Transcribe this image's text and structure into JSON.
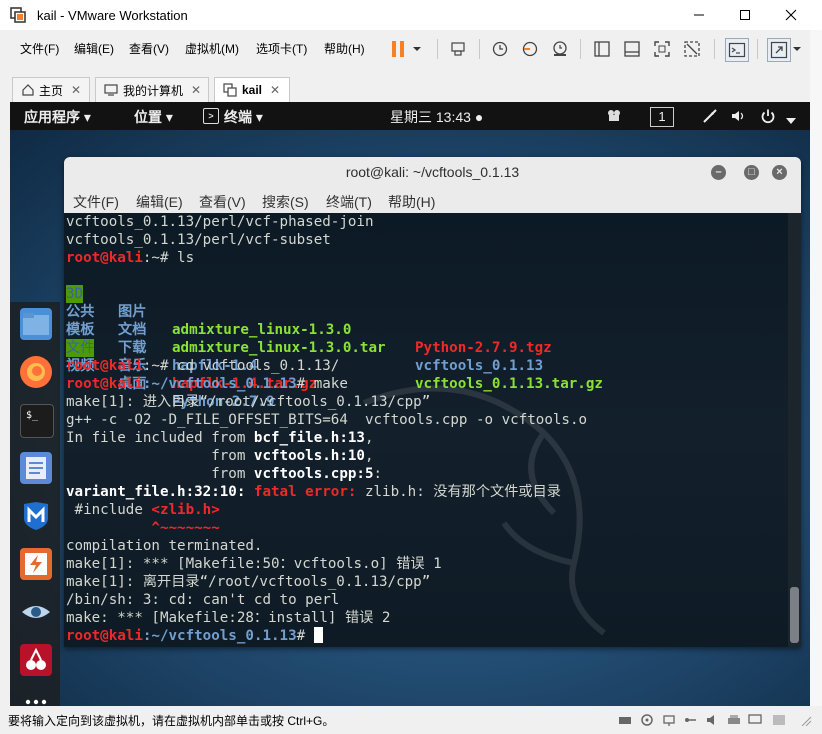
{
  "window": {
    "title": "kail - VMware Workstation"
  },
  "menubar": {
    "file": "文件(F)",
    "edit": "编辑(E)",
    "view": "查看(V)",
    "vm": "虚拟机(M)",
    "tabs": "选项卡(T)",
    "help": "帮助(H)"
  },
  "tabs": [
    {
      "label": "主页"
    },
    {
      "label": "我的计算机"
    },
    {
      "label": "kail"
    }
  ],
  "gnome": {
    "apps": "应用程序 ▾",
    "places": "位置 ▾",
    "terminal": "终端 ▾",
    "clock": "星期三 13:43 ●",
    "workspace": "1"
  },
  "terminal": {
    "title": "root@kali: ~/vcftools_0.1.13",
    "menu": {
      "file": "文件(F)",
      "edit": "编辑(E)",
      "view": "查看(V)",
      "search": "搜索(S)",
      "terminal": "终端(T)",
      "help": "帮助(H)"
    },
    "lines": {
      "l1": "vcftools_0.1.13/perl/vcf-phased-join",
      "l2": "vcftools_0.1.13/perl/vcf-subset",
      "l3_prompt_user": "root@kali",
      "l3_rest": ":~# ls",
      "ls_r1_c1": "3D",
      "ls_r1_c2": "图片",
      "ls_r1_c3": "admixture_linux-1.3.0",
      "ls_r1_c4": "Python-2.7.9.tgz",
      "ls_r2_c1": "公共",
      "ls_r2_c2": "文档",
      "ls_r2_c3": "admixture_linux-1.3.0.tar",
      "ls_r2_c4": "vcftools_0.1.13",
      "ls_r3_c1": "模板",
      "ls_r3_c2": "下载",
      "ls_r3_c3": "hapflk-1.4",
      "ls_r3_c4": "vcftools_0.1.13.tar.gz",
      "ls_r4_c1": "文件",
      "ls_r4_c2": "音乐",
      "ls_r4_c3": "hapflk-1.4.tar.gz",
      "ls_r5_c1": "视频",
      "ls_r5_c2": "桌面",
      "ls_r5_c3": "Python-2.7.9",
      "cd_user": "root@kali",
      "cd_rest": ":~# cd vcftools_0.1.13/",
      "make_user": "root@kali",
      "make_path": ":~/vcftools_0.1.13",
      "make_cmd": "# make",
      "m1": "make[1]: 进入目录“/root/vcftools_0.1.13/cpp”",
      "m2": "g++ -c -O2 -D_FILE_OFFSET_BITS=64  vcftools.cpp -o vcftools.o",
      "m3a": "In file included from ",
      "m3b": "bcf_file.h:13",
      "m3c": ",",
      "m4a": "                 from ",
      "m4b": "vcftools.h:10",
      "m4c": ",",
      "m5a": "                 from ",
      "m5b": "vcftools.cpp:5",
      "m5c": ":",
      "m6a": "variant_file.h:32:10: ",
      "m6b": "fatal error: ",
      "m6c": "zlib.h: 没有那个文件或目录",
      "m7a": " #include ",
      "m7b": "<zlib.h>",
      "m8": "          ^~~~~~~~",
      "m9": "compilation terminated.",
      "m10": "make[1]: *** [Makefile:50：vcftools.o] 错误 1",
      "m11": "make[1]: 离开目录“/root/vcftools_0.1.13/cpp”",
      "m12": "/bin/sh: 3: cd: can't cd to perl",
      "m13": "make: *** [Makefile:28：install] 错误 2",
      "last_user": "root@kali",
      "last_path": ":~/vcftools_0.1.13",
      "last_cmd": "# "
    }
  },
  "status": {
    "text": "要将输入定向到该虚拟机，请在虚拟机内部单击或按 Ctrl+G。"
  },
  "colors": {
    "prompt": "#ef2929",
    "directory": "#729fcf",
    "archive": "#ef2929",
    "executable": "#8ae234"
  }
}
